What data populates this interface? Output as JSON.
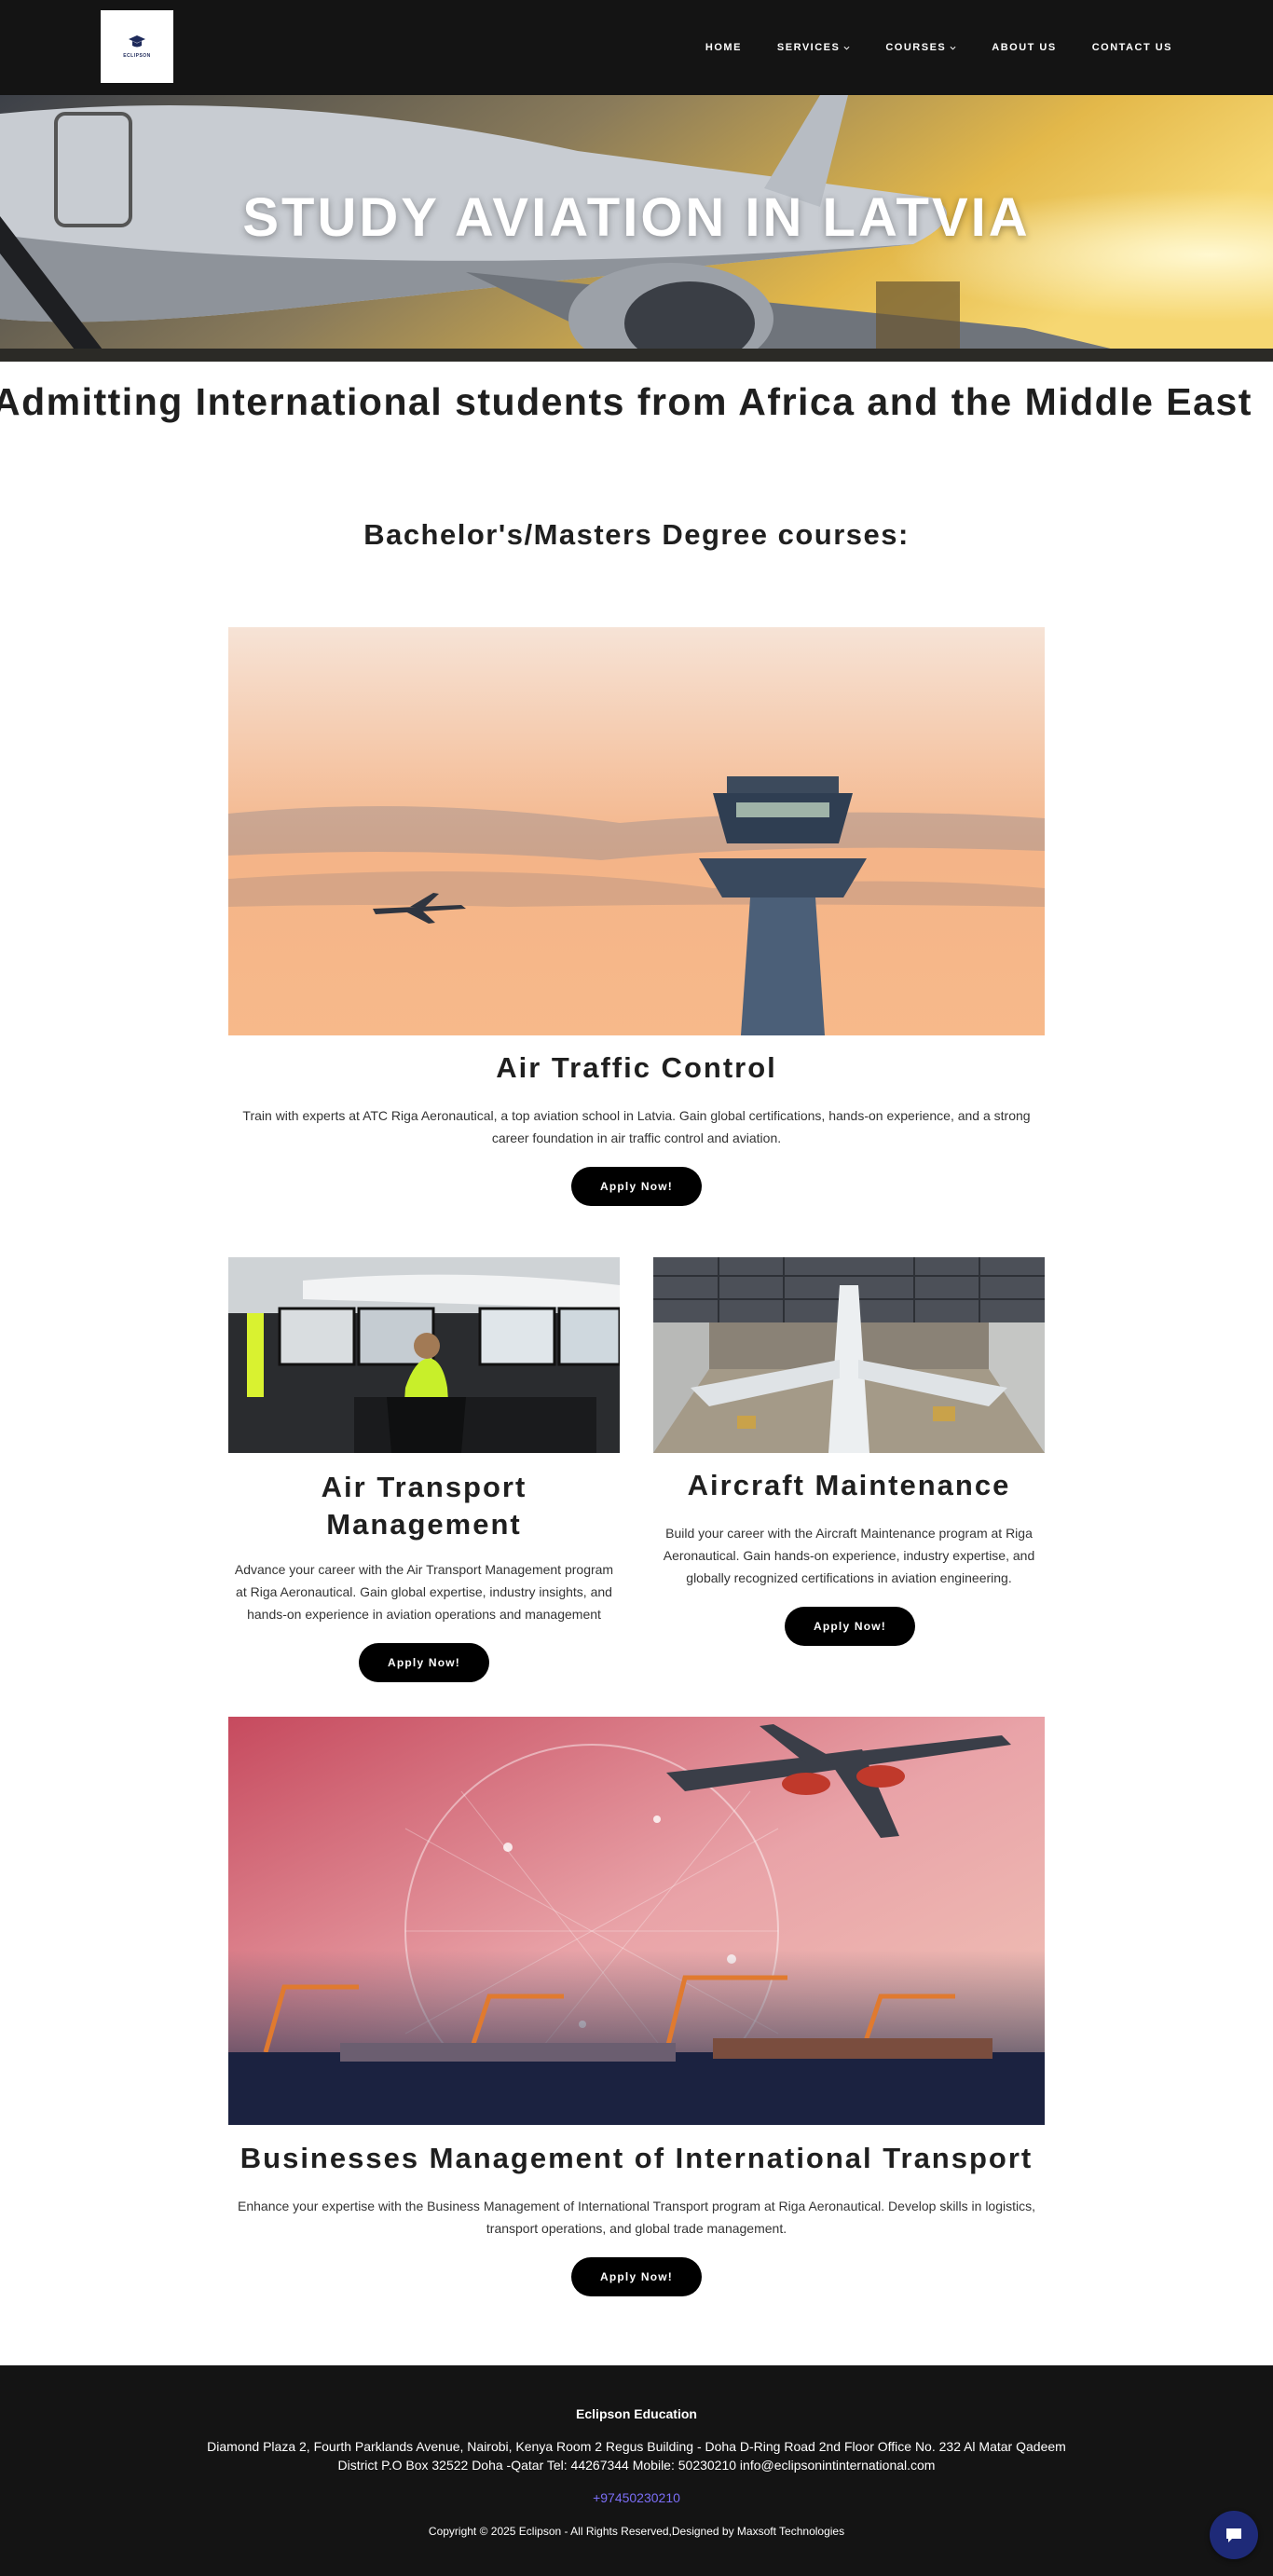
{
  "header": {
    "logo_text": "ECLIPSON",
    "nav": [
      {
        "label": "HOME",
        "has_dropdown": false
      },
      {
        "label": "SERVICES",
        "has_dropdown": true
      },
      {
        "label": "COURSES",
        "has_dropdown": true
      },
      {
        "label": "ABOUT US",
        "has_dropdown": false
      },
      {
        "label": "CONTACT US",
        "has_dropdown": false
      }
    ]
  },
  "hero": {
    "title": "STUDY AVIATION IN LATVIA"
  },
  "banner": {
    "text": "Admitting International students from Africa and the Middle East"
  },
  "courses_section": {
    "title": "Bachelor's/Masters Degree courses:"
  },
  "courses": [
    {
      "title": "Air Traffic Control",
      "description": "Train with experts at ATC Riga Aeronautical, a top aviation school in Latvia. Gain global certifications, hands-on experience, and a strong career foundation in air traffic control and aviation.",
      "button": "Apply Now!"
    },
    {
      "title": "Air Transport Management",
      "description": "Advance your career with the Air Transport Management program at Riga Aeronautical. Gain global expertise, industry insights, and hands-on experience in aviation operations and management",
      "button": "Apply Now!"
    },
    {
      "title": "Aircraft Maintenance",
      "description": "Build your career with the Aircraft Maintenance program at Riga Aeronautical. Gain hands-on experience, industry expertise, and globally recognized certifications in aviation engineering.",
      "button": "Apply Now!"
    },
    {
      "title": "Businesses Management of International Transport",
      "description": "Enhance your expertise with the Business Management of International Transport program at Riga Aeronautical. Develop skills in logistics, transport operations, and global trade management.",
      "button": "Apply Now!"
    }
  ],
  "footer": {
    "brand": "Eclipson Education",
    "address": "Diamond Plaza 2, Fourth Parklands Avenue, Nairobi, Kenya Room 2 Regus Building - Doha D-Ring Road 2nd Floor Office No. 232 Al Matar Qadeem District P.O Box 32522 Doha -Qatar Tel: 44267344 Mobile: 50230210 info@eclipsonintinternational.com",
    "phone": "+97450230210",
    "copyright": "Copyright © 2025 Eclipson - All Rights Reserved,Designed by Maxsoft Technologies"
  },
  "colors": {
    "header_bg": "#141414",
    "button_bg": "#000000",
    "link": "#7b6ef6",
    "chat_button": "#1e2a78"
  },
  "icons": [
    "chevron-down-icon",
    "chat-icon",
    "logo-icon"
  ]
}
